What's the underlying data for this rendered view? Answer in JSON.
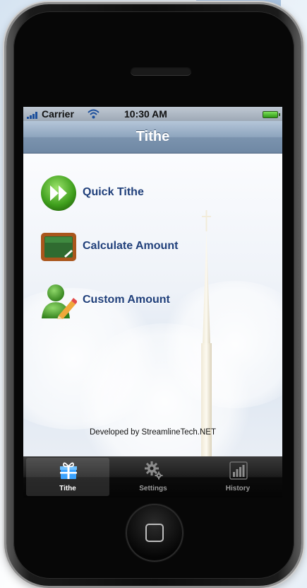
{
  "status_bar": {
    "carrier": "Carrier",
    "time": "10:30 AM",
    "icons": [
      "signal-bars-icon",
      "wifi-icon",
      "battery-icon"
    ]
  },
  "nav_bar": {
    "title": "Tithe"
  },
  "menu": {
    "items": [
      {
        "label": "Quick Tithe",
        "icon": "fast-forward-icon"
      },
      {
        "label": "Calculate Amount",
        "icon": "chalkboard-icon"
      },
      {
        "label": "Custom Amount",
        "icon": "user-pencil-icon"
      }
    ]
  },
  "footer": {
    "credit": "Developed by StreamlineTech.NET"
  },
  "tab_bar": {
    "selected": "Tithe",
    "tabs": [
      {
        "label": "Tithe",
        "icon": "gift-icon"
      },
      {
        "label": "Settings",
        "icon": "gears-icon"
      },
      {
        "label": "History",
        "icon": "bar-chart-icon"
      }
    ]
  },
  "colors": {
    "nav_bar": "#8ea5be",
    "menu_label": "#1f3f7a",
    "tab_bar": "#1c1c1c",
    "selected_tab_icon": "#3aa3ff"
  }
}
